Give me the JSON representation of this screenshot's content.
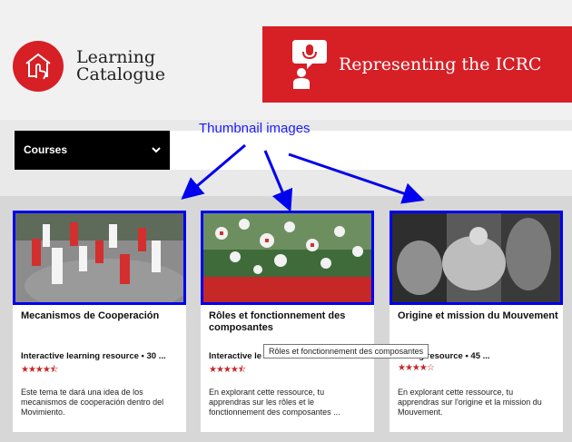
{
  "header": {
    "logo_line1": "Learning",
    "logo_line2": "Catalogue",
    "banner_title": "Representing the ICRC",
    "banner_icon": "speaker-microphone-icon"
  },
  "filter": {
    "dropdown_label": "Courses"
  },
  "annotation": {
    "label": "Thumbnail images"
  },
  "cards": [
    {
      "title": "Mecanismos de Cooperación",
      "meta": "Interactive learning resource • 30 ...",
      "rating": 4.5,
      "stars": "★★★★⯪",
      "description": "Este tema te dará una idea de los mecanismos de cooperación dentro del Movimiento."
    },
    {
      "title": "Rôles et fonctionnement des composantes",
      "meta": "Interactive le",
      "rating": 4.5,
      "stars": "★★★★⯪",
      "description": "En explorant cette ressource, tu apprendras sur les rôles et le fonctionnement des composantes ..."
    },
    {
      "title": "Origine et mission du Mouvement",
      "meta": "arning resource • 45 ...",
      "rating": 4,
      "stars": "★★★★☆",
      "description": "En explorant cette ressource, tu apprendras sur l'origine et la mission du Mouvement."
    }
  ],
  "tooltip": "Rôles et fonctionnement des composantes",
  "colors": {
    "brand_red": "#d71f26",
    "annotation_blue": "#0000ee",
    "star_red": "#c62828"
  }
}
